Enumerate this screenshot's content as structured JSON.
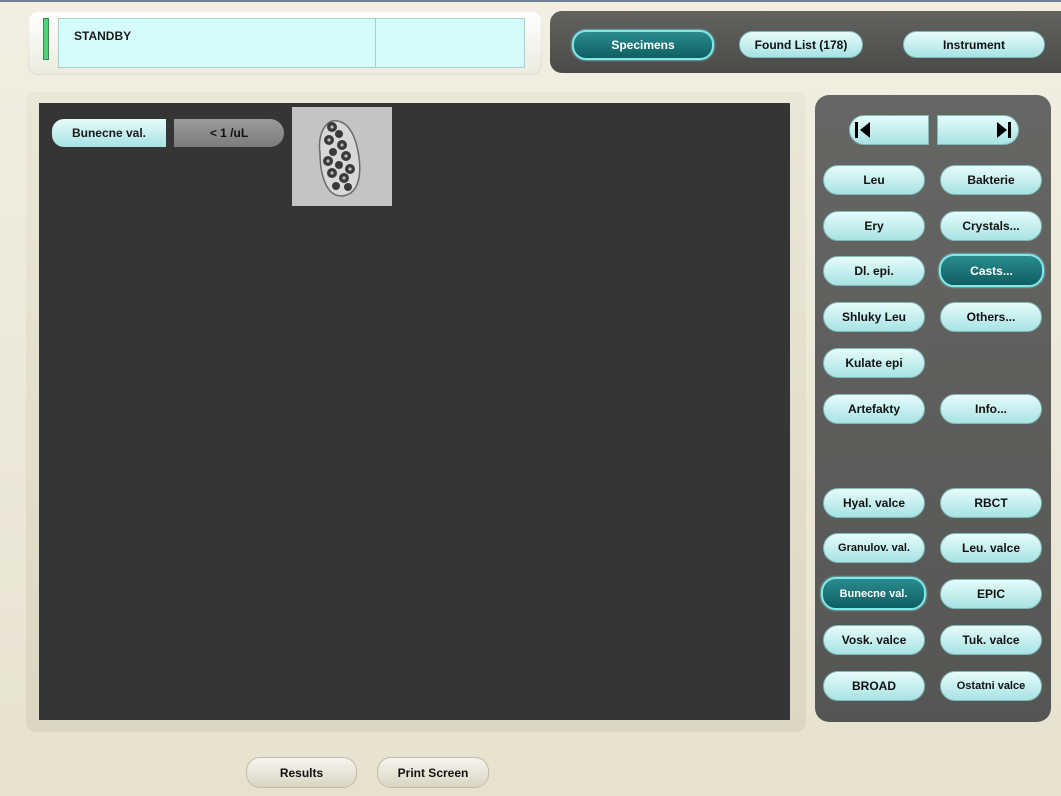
{
  "status": {
    "text": "STANDBY",
    "led_color": "#53d07a"
  },
  "tabs": {
    "specimens": "Specimens",
    "found_list": "Found List (178)",
    "instrument": "Instrument"
  },
  "viewer": {
    "class_label": "Bunecne val.",
    "count": "< 1 /uL",
    "thumbnail_icon": "cell-cast-image"
  },
  "nav": {
    "prev_icon": "arrow-left-icon",
    "next_icon": "arrow-right-icon"
  },
  "classes": {
    "leu": "Leu",
    "bakterie": "Bakterie",
    "ery": "Ery",
    "crystals": "Crystals...",
    "dl_epi": "Dl. epi.",
    "casts": "Casts...",
    "shluky_leu": "Shluky Leu",
    "others": "Others...",
    "kulate_epi": "Kulate epi",
    "artefakty": "Artefakty",
    "info": "Info...",
    "hyal_valce": "Hyal. valce",
    "rbct": "RBCT",
    "granulov_val": "Granulov. val.",
    "leu_valce": "Leu. valce",
    "bunecne_val": "Bunecne val.",
    "epic": "EPIC",
    "vosk_valce": "Vosk. valce",
    "tuk_valce": "Tuk. valce",
    "broad": "BROAD",
    "ostatni_valce": "Ostatni valce"
  },
  "bottom": {
    "results": "Results",
    "print_screen": "Print Screen"
  },
  "colors": {
    "accent_light": "#a8e3e3",
    "accent_dark": "#0e5e62",
    "viewer_bg": "#353535",
    "panel_bg": "#5e5f5c"
  }
}
